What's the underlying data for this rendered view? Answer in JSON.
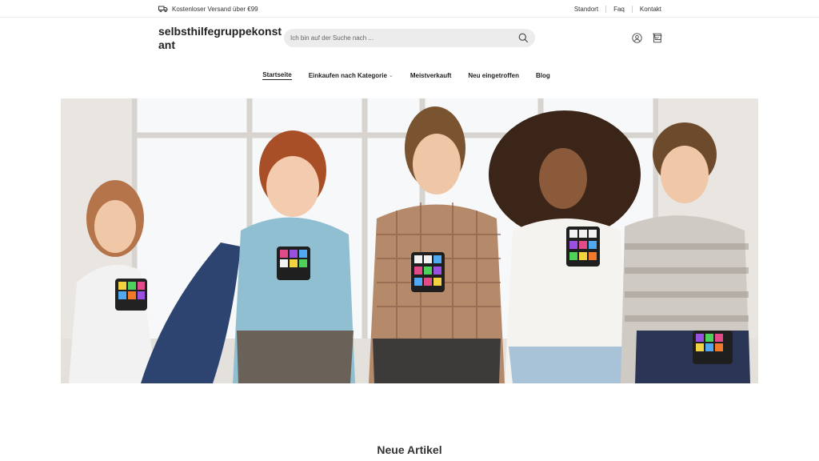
{
  "topbar": {
    "shipping_text": "Kostenloser Versand über €99",
    "links": [
      "Standort",
      "Faq",
      "Kontakt"
    ]
  },
  "header": {
    "logo": "selbsthilfegruppekonstant",
    "search_placeholder": "Ich bin auf der Suche nach ..."
  },
  "nav": {
    "items": [
      "Startseite",
      "Einkaufen nach Kategorie",
      "Meistverkauft",
      "Neu eingetroffen",
      "Blog"
    ]
  },
  "main": {
    "section_title": "Neue Artikel"
  }
}
